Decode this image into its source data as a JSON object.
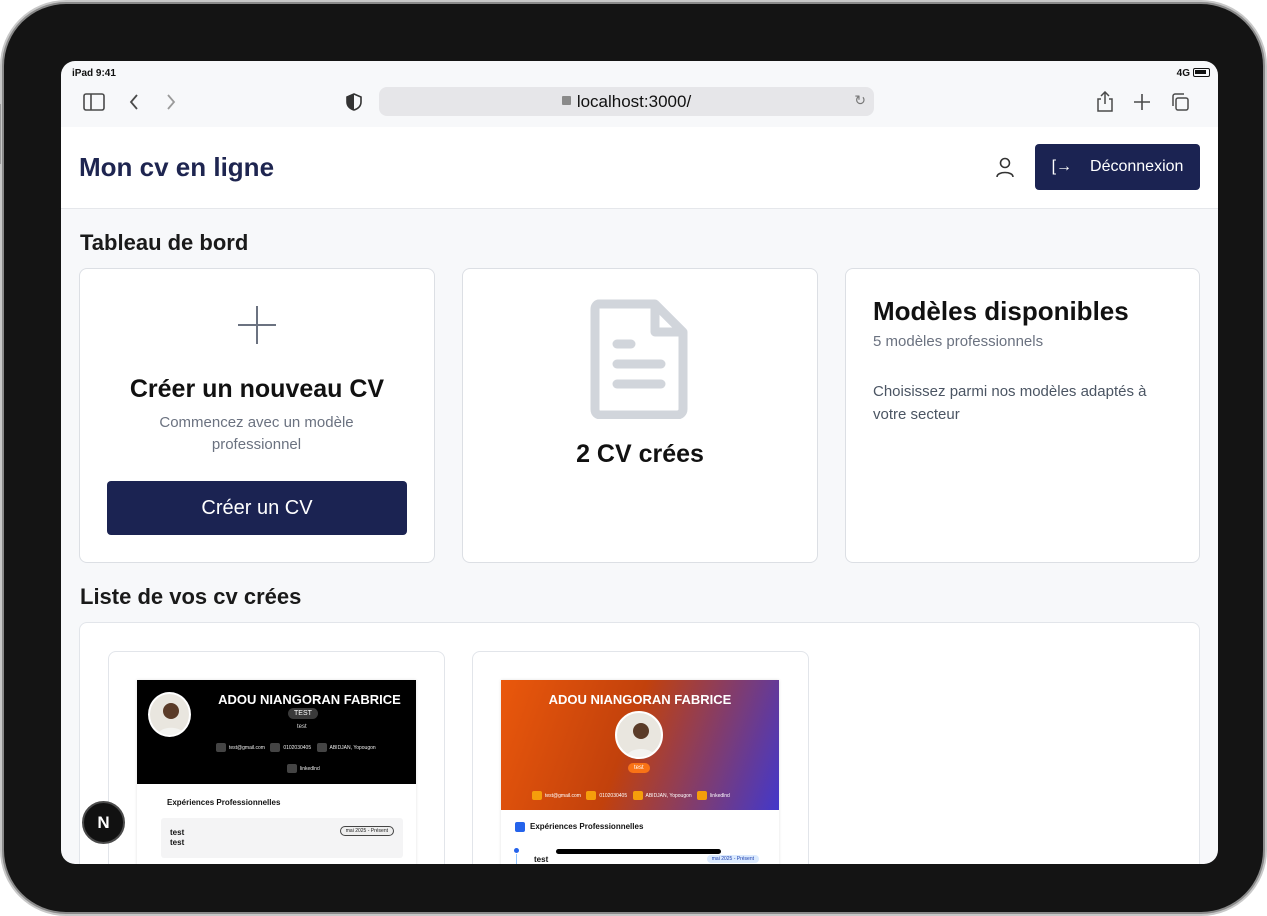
{
  "status_bar": {
    "time": "iPad 9:41",
    "network": "4G"
  },
  "browser": {
    "url": "localhost:3000/"
  },
  "header": {
    "title": "Mon cv en ligne",
    "logout_label": "Déconnexion"
  },
  "dashboard": {
    "title": "Tableau de bord",
    "create_card": {
      "title": "Créer un nouveau CV",
      "subtitle": "Commencez avec un modèle professionnel",
      "button_label": "Créer un CV"
    },
    "count_card": {
      "text": "2 CV crées"
    },
    "models_card": {
      "title": "Modèles disponibles",
      "subtitle": "5 modèles professionnels",
      "description": "Choisissez parmi nos modèles adaptés à votre secteur"
    }
  },
  "cv_list": {
    "title": "Liste de vos cv crées",
    "items": [
      {
        "name": "ADOU NIANGORAN FABRICE",
        "badge": "TEST",
        "subtitle": "test",
        "email": "test@gmail.com",
        "phone": "0102030405",
        "location": "ABIDJAN, Yopougon",
        "linkedin": "linkedlnd",
        "section": "Expériences Professionnelles",
        "exp_title": "test",
        "exp_company": "test",
        "exp_date": "mai 2025 - Présent"
      },
      {
        "name": "ADOU NIANGORAN FABRICE",
        "badge": "test",
        "email": "test@gmail.com",
        "phone": "0102030405",
        "location": "ABIDJAN, Yopougon",
        "linkedin": "linkedlnd",
        "section": "Expériences Professionnelles",
        "exp_title": "test",
        "exp_date": "mai 2025 - Présent"
      }
    ]
  },
  "dev_badge": {
    "label": "N"
  },
  "colors": {
    "primary": "#1b2352",
    "title": "#1e2550"
  }
}
